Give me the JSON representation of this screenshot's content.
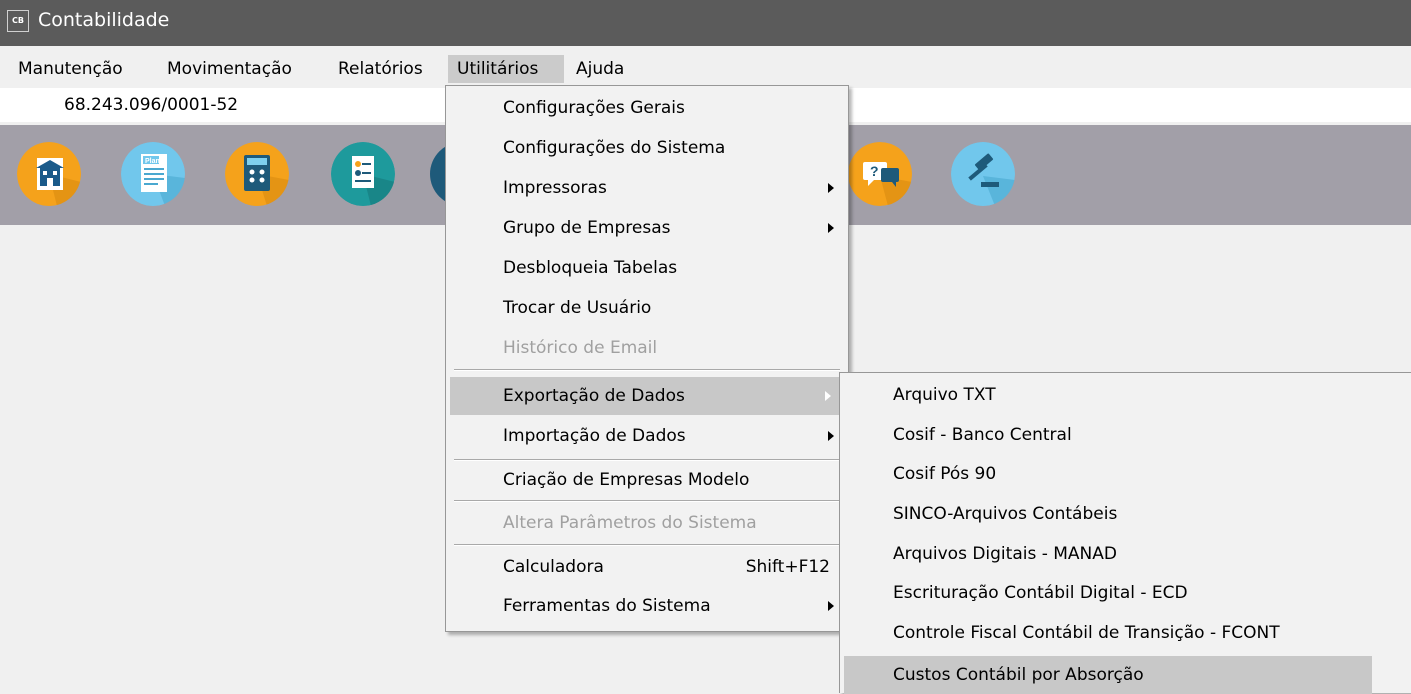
{
  "window": {
    "title": "Contabilidade",
    "icon_text": "CB"
  },
  "menubar": {
    "items": [
      {
        "label": "Manutenção"
      },
      {
        "label": "Movimentação"
      },
      {
        "label": "Relatórios"
      },
      {
        "label": "Utilitários"
      },
      {
        "label": "Ajuda"
      }
    ]
  },
  "company": {
    "cnpj": "68.243.096/0001-52"
  },
  "toolbar": {
    "icons": [
      {
        "name": "company-icon",
        "color": "#f5a21b"
      },
      {
        "name": "plan-of-accounts-icon",
        "label": "Plano",
        "color": "#71c7ec"
      },
      {
        "name": "calculator-icon",
        "color": "#f5a21b"
      },
      {
        "name": "report-icon",
        "color": "#1e9a9c"
      },
      {
        "name": "help-chat-icon",
        "color": "#f5a21b"
      },
      {
        "name": "gavel-icon",
        "color": "#71c7ec"
      }
    ]
  },
  "utilities_menu": {
    "items": [
      {
        "label": "Configurações Gerais"
      },
      {
        "label": "Configurações do Sistema"
      },
      {
        "label": "Impressoras",
        "submenu": true
      },
      {
        "label": "Grupo de Empresas",
        "submenu": true
      },
      {
        "label": "Desbloqueia Tabelas"
      },
      {
        "label": "Trocar de Usuário"
      },
      {
        "label": "Histórico de Email",
        "disabled": true
      },
      {
        "label": "Exportação de Dados",
        "submenu": true,
        "highlighted": true
      },
      {
        "label": "Importação de Dados",
        "submenu": true
      },
      {
        "label": "Criação de Empresas Modelo"
      },
      {
        "label": "Altera Parâmetros do Sistema",
        "disabled": true
      },
      {
        "label": "Calculadora",
        "shortcut": "Shift+F12"
      },
      {
        "label": "Ferramentas do Sistema",
        "submenu": true
      }
    ]
  },
  "export_submenu": {
    "items": [
      {
        "label": "Arquivo TXT"
      },
      {
        "label": "Cosif - Banco Central"
      },
      {
        "label": "Cosif Pós 90"
      },
      {
        "label": "SINCO-Arquivos Contábeis"
      },
      {
        "label": "Arquivos Digitais - MANAD"
      },
      {
        "label": "Escrituração Contábil Digital - ECD"
      },
      {
        "label": "Controle Fiscal Contábil de Transição - FCONT"
      },
      {
        "label": "Custos Contábil por Absorção",
        "highlighted": true
      }
    ]
  }
}
